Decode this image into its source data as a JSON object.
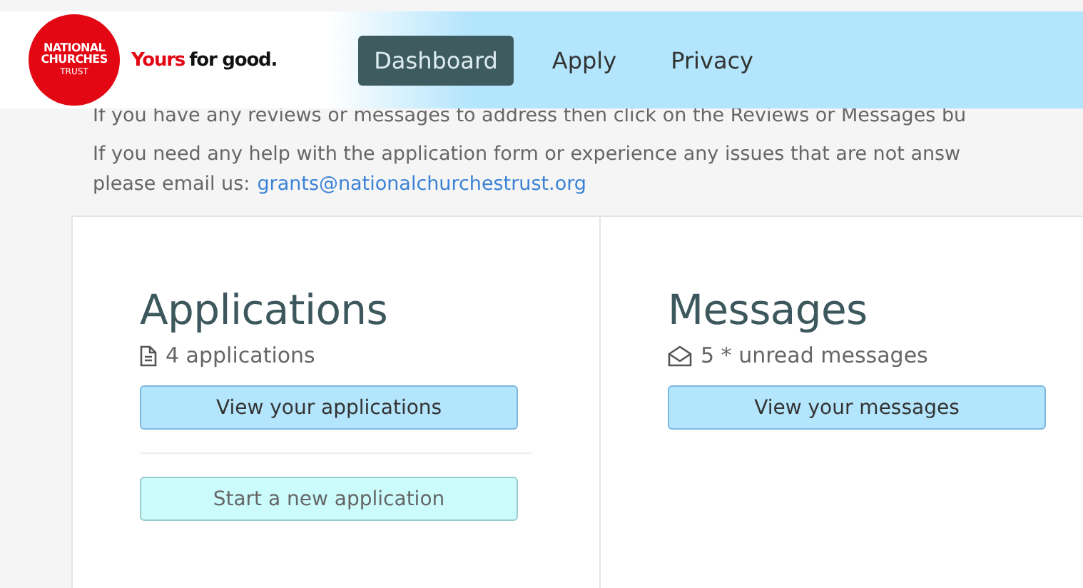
{
  "logo": {
    "lines": [
      "NATIONAL",
      "CHURCHES",
      "TRUST"
    ],
    "tagline_highlight": "Yours",
    "tagline_rest": "for good."
  },
  "nav": [
    {
      "label": "Dashboard",
      "selected": true
    },
    {
      "label": "Apply",
      "selected": false
    },
    {
      "label": "Privacy",
      "selected": false
    }
  ],
  "intro": {
    "hidden_line": "If you have any reviews or messages to address then click on the Reviews or Messages bu",
    "help_text": "If you need any help with the application form or experience any issues that are not answ",
    "email_prefix": "please email us:",
    "email": "grants@nationalchurchestrust.org"
  },
  "cards": [
    {
      "title": "Applications",
      "kind": "document",
      "count": "4 applications",
      "buttons": [
        {
          "label": "View your applications",
          "kind": "primary"
        },
        {
          "label": "Start a new application",
          "kind": "secondary"
        }
      ]
    },
    {
      "title": "Messages",
      "kind": "envelope",
      "count": "5 * unread messages",
      "buttons": [
        {
          "label": "View your messages",
          "kind": "primary"
        }
      ]
    }
  ]
}
